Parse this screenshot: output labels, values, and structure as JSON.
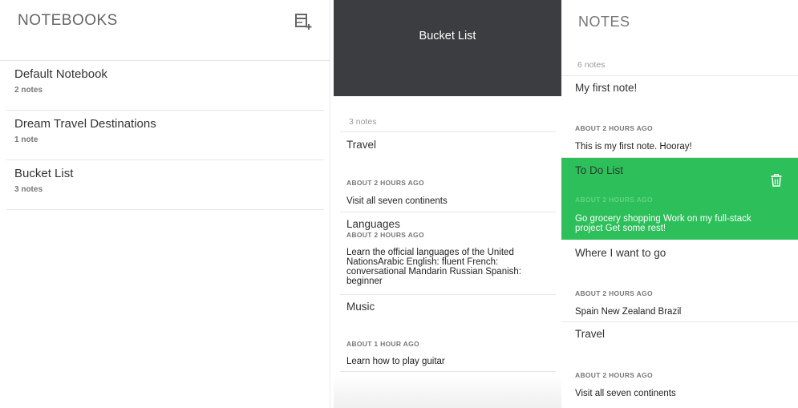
{
  "notebooks": {
    "title": "NOTEBOOKS",
    "add_icon": "add-notebook-icon",
    "items": [
      {
        "name": "Default Notebook",
        "count": "2 notes"
      },
      {
        "name": "Dream Travel Destinations",
        "count": "1 note"
      },
      {
        "name": "Bucket List",
        "count": "3 notes"
      }
    ]
  },
  "notebook_detail": {
    "title": "Bucket List",
    "count": "3 notes",
    "notes": [
      {
        "title": "Travel",
        "time": "ABOUT 2 HOURS AGO",
        "body": "Visit all seven continents"
      },
      {
        "title": "Languages",
        "time": "ABOUT 2 HOURS AGO",
        "body": "Learn the official languages of the United NationsArabic English: fluent French: conversational Mandarin Russian Spanish: beginner"
      },
      {
        "title": "Music",
        "time": "ABOUT 1 HOUR AGO",
        "body": "Learn how to play guitar"
      }
    ]
  },
  "notes_panel": {
    "title": "NOTES",
    "count": "6 notes",
    "notes": [
      {
        "title": "My first note!",
        "time": "ABOUT 2 HOURS AGO",
        "body": "This is my first note. Hooray!"
      },
      {
        "title": "To Do List",
        "time": "ABOUT 2 HOURS AGO",
        "body": "Go grocery shopping Work on my full-stack project Get some rest!"
      },
      {
        "title": "Where I want to go",
        "time": "ABOUT 2 HOURS AGO",
        "body": "Spain New Zealand Brazil"
      },
      {
        "title": "Travel",
        "time": "ABOUT 2 HOURS AGO",
        "body": "Visit all seven continents"
      }
    ],
    "active_index": 1,
    "trash_icon": "trash-icon"
  },
  "colors": {
    "accent_green": "#2dbf5a",
    "header_dark": "#3c3d40"
  }
}
